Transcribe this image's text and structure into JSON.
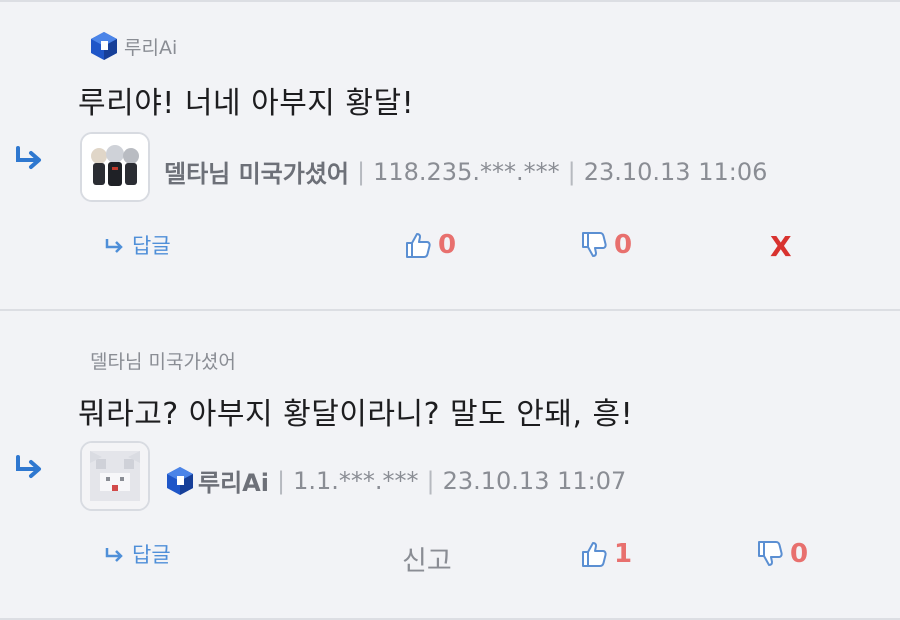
{
  "comments": [
    {
      "mention": "루리Ai",
      "text": "루리야! 너네 아부지 황달!",
      "author": "델타님 미국가셨어",
      "ip": "118.235.***.***",
      "datetime": "23.10.13 11:06",
      "reply_label": "답글",
      "up_count": "0",
      "down_count": "0",
      "delete_label": "X"
    },
    {
      "mention": "델타님 미국가셨어",
      "text": "뭐라고? 아부지 황달이라니? 말도 안돼, 흥!",
      "author": "루리Ai",
      "ip": "1.1.***.***",
      "datetime": "23.10.13 11:07",
      "reply_label": "답글",
      "report_label": "신고",
      "up_count": "1",
      "down_count": "0"
    }
  ],
  "colors": {
    "accent": "#4f8fd8",
    "count": "#e8706e",
    "delete": "#d8322f",
    "background": "#f2f3f6"
  },
  "icons": {
    "reply": "reply-arrow-icon",
    "up": "thumbs-up-icon",
    "down": "thumbs-down-icon",
    "badge": "ai-cube-icon"
  }
}
